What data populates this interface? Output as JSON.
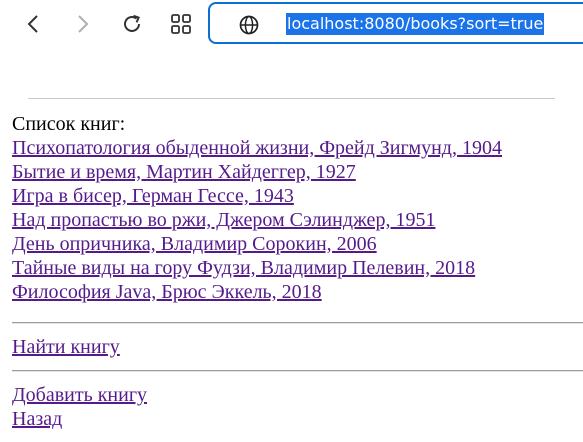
{
  "browser": {
    "url": "localhost:8080/books?sort=true",
    "icons": [
      "back-arrow-icon",
      "forward-arrow-icon",
      "reload-icon",
      "apps-grid-icon",
      "globe-icon"
    ],
    "accent": "#0b6fd6",
    "selection": "#1a73e8"
  },
  "page": {
    "list_title": "Список книг:",
    "books": [
      "Психопатология обыденной жизни, Фрейд Зигмунд, 1904",
      "Бытие и время, Мартин Хайдеггер, 1927",
      "Игра в бисер, Герман Гессе, 1943",
      "Над пропастью во ржи, Джером Сэлинджер, 1951",
      "День опричника, Владимир Сорокин, 2006",
      "Тайные виды на гору Фудзи, Владимир Пелевин, 2018",
      "Философия Java, Брюс Эккель, 2018"
    ],
    "find_book": "Найти книгу",
    "add_book": "Добавить книгу",
    "back": "Назад",
    "link_color": "#551a8b"
  }
}
